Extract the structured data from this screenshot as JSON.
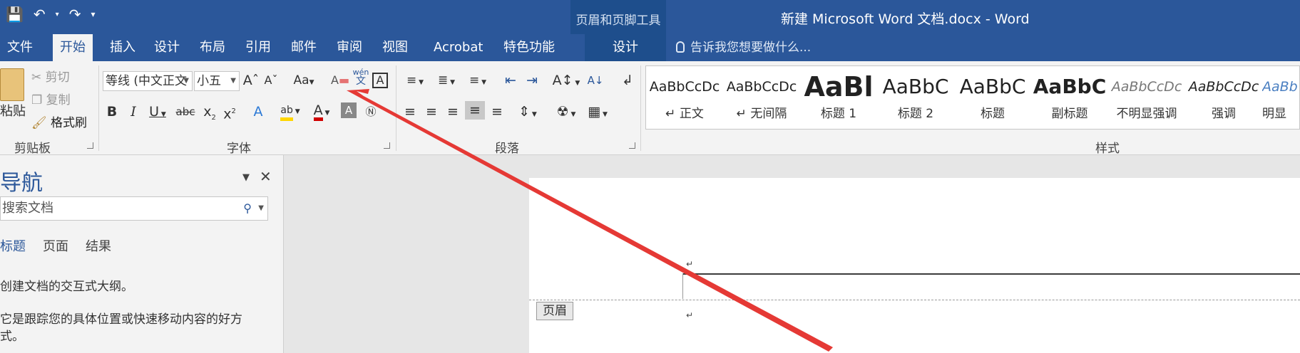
{
  "colors": {
    "brand": "#2b579a",
    "context": "#1e4e8c",
    "annotation_arrow": "#e53935",
    "highlight": "#ffd600",
    "font_color": "#d00000"
  },
  "window": {
    "title": "新建 Microsoft Word 文档.docx - Word",
    "contextual_tool": "页眉和页脚工具"
  },
  "qat": {
    "save_icon": "save-icon",
    "undo_icon": "undo-icon",
    "redo_icon": "redo-icon"
  },
  "tabs": [
    "文件",
    "开始",
    "插入",
    "设计",
    "布局",
    "引用",
    "邮件",
    "审阅",
    "视图",
    "Acrobat",
    "特色功能"
  ],
  "context_tab": "设计",
  "tell_me": "告诉我您想要做什么...",
  "clipboard": {
    "paste": "粘贴",
    "cut": "剪切",
    "copy": "复制",
    "format_painter": "格式刷",
    "group_label": "剪贴板"
  },
  "font": {
    "font_name": "等线 (中文正文",
    "font_size": "小五",
    "group_label": "字体",
    "change_case": "Aa",
    "phonetic_top": "wén",
    "phonetic_bottom": "文"
  },
  "paragraph": {
    "group_label": "段落"
  },
  "styles": {
    "group_label": "样式",
    "items": [
      {
        "sample": "AaBbCcDc",
        "name": "↵ 正文"
      },
      {
        "sample": "AaBbCcDc",
        "name": "↵ 无间隔"
      },
      {
        "sample": "AaBl",
        "name": "标题 1"
      },
      {
        "sample": "AaBbC",
        "name": "标题 2"
      },
      {
        "sample": "AaBbC",
        "name": "标题"
      },
      {
        "sample": "AaBbC",
        "name": "副标题"
      },
      {
        "sample": "AaBbCcDc",
        "name": "不明显强调"
      },
      {
        "sample": "AaBbCcDc",
        "name": "强调"
      },
      {
        "sample": "AaBb",
        "name": "明显"
      }
    ]
  },
  "nav": {
    "title": "导航",
    "search_placeholder": "搜索文档",
    "tabs": [
      "标题",
      "页面",
      "结果"
    ],
    "line1": "创建文档的交互式大纲。",
    "line2": "它是跟踪您的具体位置或快速移动内容的好方",
    "line3": "式。"
  },
  "document": {
    "header_tag": "页眉",
    "para_mark": "↵"
  }
}
